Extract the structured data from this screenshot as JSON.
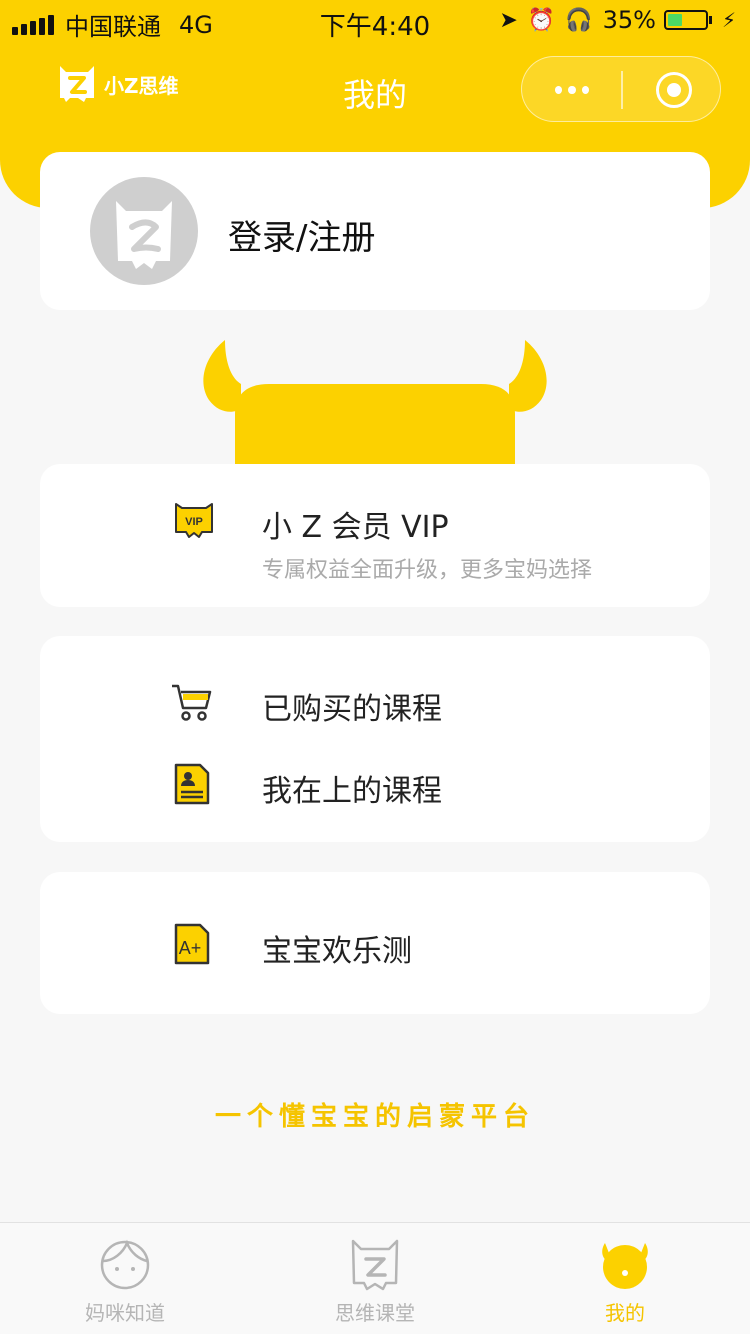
{
  "status_bar": {
    "carrier": "中国联通",
    "network": "4G",
    "time": "下午4:40",
    "battery": "35%"
  },
  "nav": {
    "logo_text": "小Z思维",
    "title": "我的"
  },
  "login": {
    "label": "登录/注册"
  },
  "vip": {
    "title": "小 Z 会员 VIP",
    "subtitle": "专属权益全面升级，更多宝妈选择",
    "icon": "vip-badge-icon"
  },
  "courses": {
    "items": [
      {
        "label": "已购买的课程",
        "icon": "cart-icon"
      },
      {
        "label": "我在上的课程",
        "icon": "document-icon"
      }
    ]
  },
  "test": {
    "label": "宝宝欢乐测",
    "icon": "a-plus-icon"
  },
  "slogan": "一个懂宝宝的启蒙平台",
  "tabbar": {
    "tabs": [
      {
        "label": "妈咪知道",
        "icon": "mom-face-icon",
        "active": false
      },
      {
        "label": "思维课堂",
        "icon": "z-logo-icon",
        "active": false
      },
      {
        "label": "我的",
        "icon": "mascot-icon",
        "active": true
      }
    ]
  },
  "colors": {
    "accent": "#fcd100",
    "slogan": "#f5c400",
    "inactive": "#b5b5b5"
  }
}
